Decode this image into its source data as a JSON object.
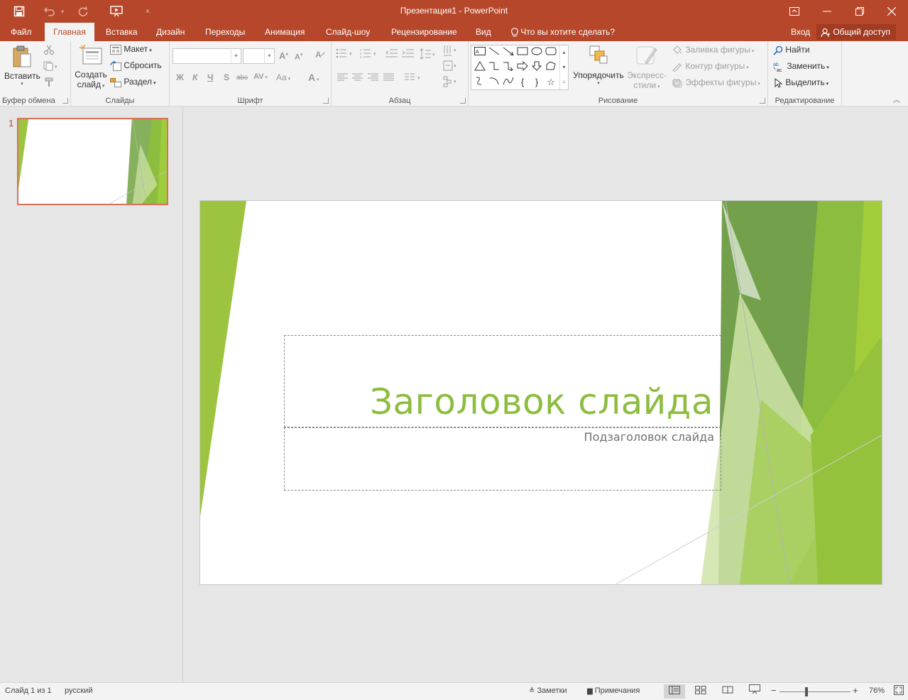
{
  "window": {
    "title": "Презентация1 - PowerPoint"
  },
  "quick_access": {
    "save_icon": "save-icon",
    "undo_icon": "undo-icon",
    "redo_icon": "redo-icon",
    "present_icon": "start-from-beginning-icon",
    "customize_icon": "customize-toolbar-icon"
  },
  "tabs": [
    {
      "label": "Файл"
    },
    {
      "label": "Главная"
    },
    {
      "label": "Вставка"
    },
    {
      "label": "Дизайн"
    },
    {
      "label": "Переходы"
    },
    {
      "label": "Анимация"
    },
    {
      "label": "Слайд-шоу"
    },
    {
      "label": "Рецензирование"
    },
    {
      "label": "Вид"
    }
  ],
  "tell_me": "Что вы хотите сделать?",
  "signin": "Вход",
  "share": "Общий доступ",
  "ribbon": {
    "clipboard": {
      "paste": "Вставить",
      "label": "Буфер обмена"
    },
    "slides": {
      "new_slide": "Создать",
      "new_slide_2": "слайд",
      "layout": "Макет",
      "reset": "Сбросить",
      "section": "Раздел",
      "label": "Слайды"
    },
    "font": {
      "bold": "Ж",
      "italic": "К",
      "underline": "Ч",
      "shadow": "S",
      "strike": "abc",
      "spacing": "AV",
      "case": "Aa",
      "grow": "A",
      "shrink": "A",
      "color": "A",
      "label": "Шрифт"
    },
    "paragraph": {
      "label": "Абзац"
    },
    "drawing": {
      "arrange": "Упорядочить",
      "quick_styles": "Экспресс-",
      "quick_styles_2": "стили",
      "fill": "Заливка фигуры",
      "outline": "Контур фигуры",
      "effects": "Эффекты фигуры",
      "label": "Рисование"
    },
    "editing": {
      "find": "Найти",
      "replace": "Заменить",
      "select": "Выделить",
      "label": "Редактирование"
    }
  },
  "thumbnail": {
    "number": "1"
  },
  "slide": {
    "title": "Заголовок слайда",
    "subtitle": "Подзаголовок слайда"
  },
  "status": {
    "slide_info": "Слайд 1 из 1",
    "language": "русский",
    "notes": "Заметки",
    "comments": "Примечания",
    "zoom": "76%",
    "zoom_level": 0.76
  },
  "colors": {
    "accent": "#b7472a",
    "title_green": "#8cbd3f"
  }
}
